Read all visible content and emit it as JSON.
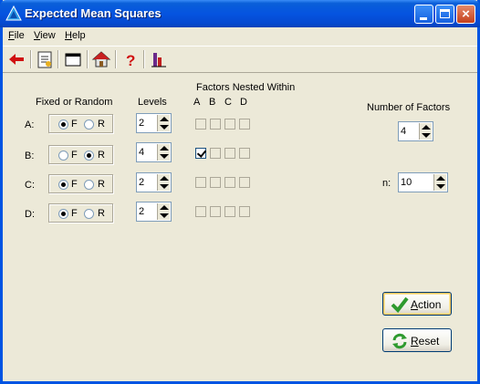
{
  "window": {
    "title": "Expected Mean Squares"
  },
  "menu": [
    {
      "label": "File",
      "accel": "F",
      "rest": "ile"
    },
    {
      "label": "View",
      "accel": "V",
      "rest": "iew"
    },
    {
      "label": "Help",
      "accel": "H",
      "rest": "elp"
    }
  ],
  "toolbar": {
    "icons": [
      "back-arrow-icon",
      "document-icon",
      "window-icon",
      "home-icon",
      "help-icon",
      "chart-icon"
    ]
  },
  "headers": {
    "fixed_random": "Fixed or Random",
    "levels": "Levels",
    "nested": "Factors Nested Within",
    "nested_cols": [
      "A",
      "B",
      "C",
      "D"
    ],
    "num_factors": "Number of Factors",
    "n": "n:"
  },
  "factors": [
    {
      "label": "A:",
      "fixed": true,
      "f_label": "F",
      "r_label": "R",
      "levels": "2",
      "nested": [
        false,
        false,
        false,
        false
      ]
    },
    {
      "label": "B:",
      "fixed": false,
      "f_label": "F",
      "r_label": "R",
      "levels": "4",
      "nested": [
        true,
        false,
        false,
        false
      ]
    },
    {
      "label": "C:",
      "fixed": true,
      "f_label": "F",
      "r_label": "R",
      "levels": "2",
      "nested": [
        false,
        false,
        false,
        false
      ]
    },
    {
      "label": "D:",
      "fixed": true,
      "f_label": "F",
      "r_label": "R",
      "levels": "2",
      "nested": [
        false,
        false,
        false,
        false
      ]
    }
  ],
  "num_factors_value": "4",
  "n_value": "10",
  "buttons": {
    "action": {
      "accel": "A",
      "rest": "ction"
    },
    "reset": {
      "accel": "R",
      "rest": "eset"
    }
  },
  "colors": {
    "titlebar": "#0554E0",
    "face": "#ECE9D8",
    "accent_green": "#2E9A2E",
    "back_red": "#D01010"
  }
}
